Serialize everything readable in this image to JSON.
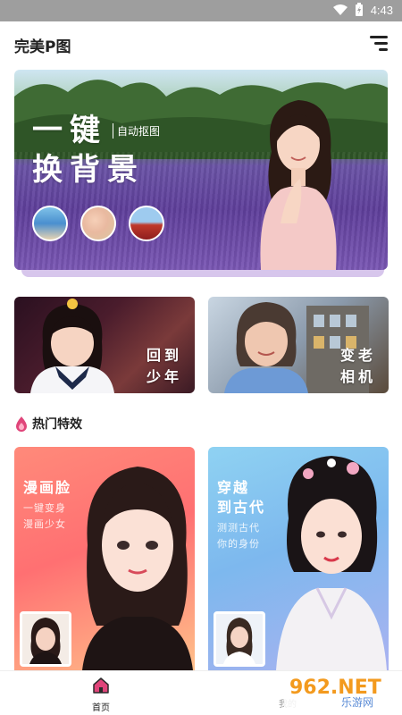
{
  "status_bar": {
    "time": "4:43"
  },
  "app": {
    "title": "完美P图",
    "menu_icon": "menu-lines-icon"
  },
  "hero": {
    "line1": "一键",
    "line2": "换背景",
    "tag": "自动抠图"
  },
  "features": [
    {
      "label_line1": "回到",
      "label_line2": "少年"
    },
    {
      "label_line1": "变老",
      "label_line2": "相机"
    }
  ],
  "hot_section": {
    "title": "热门特效",
    "icon": "flame-icon"
  },
  "effects": [
    {
      "title": "漫画脸",
      "sub1": "一键变身",
      "sub2": "漫画少女",
      "colors": [
        "#ff7a7a",
        "#ffb088"
      ]
    },
    {
      "title_line1": "穿越",
      "title_line2": "到古代",
      "sub1": "测测古代",
      "sub2": "你的身份",
      "colors": [
        "#7fc6ee",
        "#a9b8f2"
      ]
    }
  ],
  "bottom_nav": {
    "home_label": "首页",
    "home_icon": "home-icon",
    "second_label": "我的"
  },
  "watermark": {
    "brand": "962.NET",
    "sub": "乐游网"
  }
}
